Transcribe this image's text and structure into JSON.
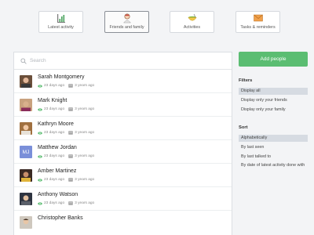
{
  "tabs": [
    {
      "label": "Latest activity",
      "icon": "bar-chart-icon"
    },
    {
      "label": "Friends and family",
      "icon": "people-icon"
    },
    {
      "label": "Activities",
      "icon": "bowl-icon"
    },
    {
      "label": "Tasks & reminders",
      "icon": "envelope-icon"
    }
  ],
  "active_tab": "Friends and family",
  "search": {
    "placeholder": "Search"
  },
  "people": [
    {
      "name": "Sarah Montgomery",
      "seen": "23 days ago",
      "talked": "3 years ago",
      "avatar": "photo"
    },
    {
      "name": "Mark Knight",
      "seen": "23 days ago",
      "talked": "3 years ago",
      "avatar": "photo"
    },
    {
      "name": "Kathryn Moore",
      "seen": "23 days ago",
      "talked": "3 years ago",
      "avatar": "photo"
    },
    {
      "name": "Matthew Jordan",
      "seen": "23 days ago",
      "talked": "3 years ago",
      "avatar": "MJ"
    },
    {
      "name": "Amber Martinez",
      "seen": "23 days ago",
      "talked": "3 years ago",
      "avatar": "photo"
    },
    {
      "name": "Anthony Watson",
      "seen": "23 days ago",
      "talked": "3 years ago",
      "avatar": "photo"
    },
    {
      "name": "Christopher Banks",
      "seen": "",
      "talked": "",
      "avatar": "photo"
    }
  ],
  "sidebar": {
    "add_button": "Add people",
    "filters_heading": "Filters",
    "filters": [
      "Display all",
      "Display only your friends",
      "Display only your family"
    ],
    "filter_selected": "Display all",
    "sort_heading": "Sort",
    "sorts": [
      "Alphabetically",
      "By last seen",
      "By last talked to",
      "By date of latest activity done with"
    ],
    "sort_selected": "Alphabetically"
  },
  "colors": {
    "accent_green": "#5bbd72",
    "selected_option": "#d6dbe2",
    "initials_avatar": "#7a8fd9"
  }
}
